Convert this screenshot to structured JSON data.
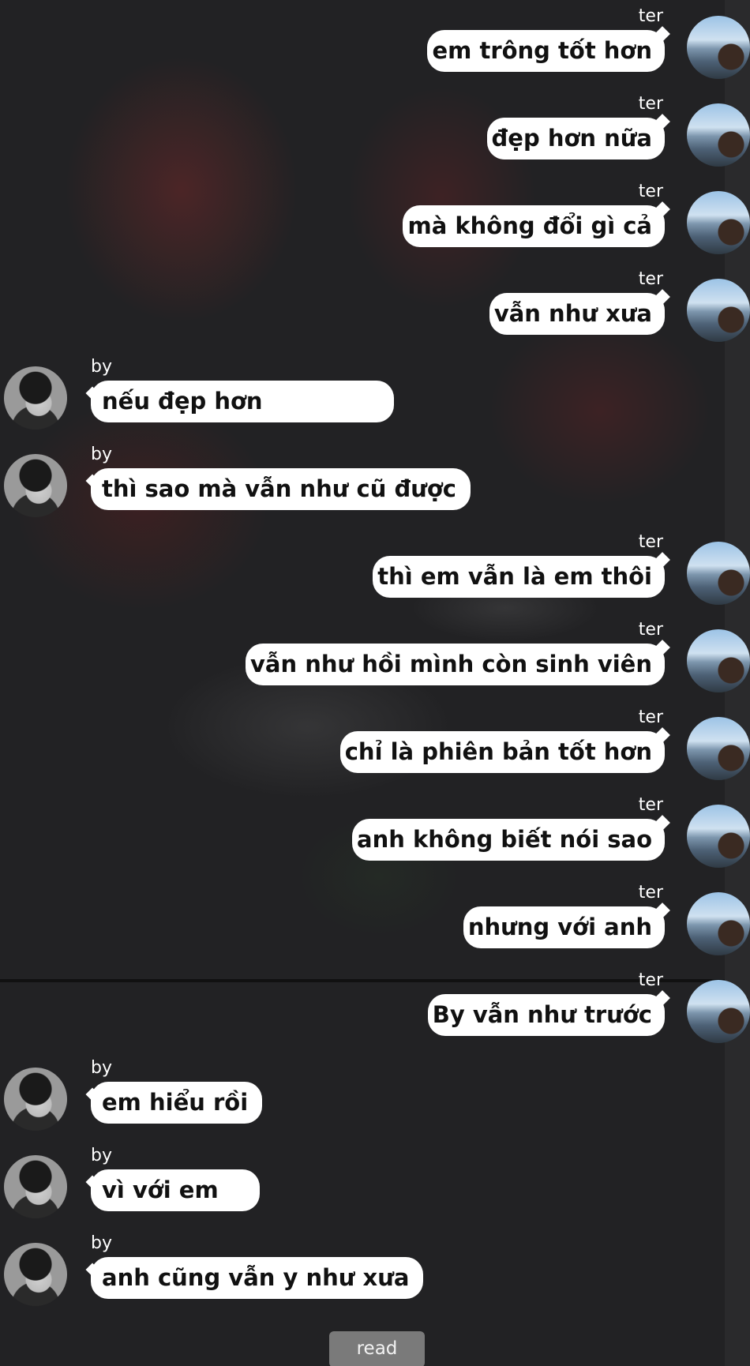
{
  "messages": [
    {
      "sender": "ter",
      "side": "right",
      "text": "em trông tốt hơn"
    },
    {
      "sender": "ter",
      "side": "right",
      "text": "đẹp hơn nữa"
    },
    {
      "sender": "ter",
      "side": "right",
      "text": "mà không đổi gì cả"
    },
    {
      "sender": "ter",
      "side": "right",
      "text": "vẫn như xưa"
    },
    {
      "sender": "by",
      "side": "left",
      "text": "nếu đẹp hơn"
    },
    {
      "sender": "by",
      "side": "left",
      "text": "thì sao mà vẫn như cũ được"
    },
    {
      "sender": "ter",
      "side": "right",
      "text": "thì em vẫn là em thôi"
    },
    {
      "sender": "ter",
      "side": "right",
      "text": "vẫn như hồi mình còn sinh viên"
    },
    {
      "sender": "ter",
      "side": "right",
      "text": "chỉ là phiên bản tốt hơn"
    },
    {
      "sender": "ter",
      "side": "right",
      "text": "anh không biết nói sao"
    },
    {
      "sender": "ter",
      "side": "right",
      "text": "nhưng với anh"
    },
    {
      "sender": "ter",
      "side": "right",
      "text": "By vẫn như trước"
    },
    {
      "sender": "by",
      "side": "left",
      "text": "em hiểu rồi"
    },
    {
      "sender": "by",
      "side": "left",
      "text": "vì với em"
    },
    {
      "sender": "by",
      "side": "left",
      "text": "anh cũng vẫn y như xưa"
    }
  ],
  "read_button": {
    "label": "read"
  }
}
